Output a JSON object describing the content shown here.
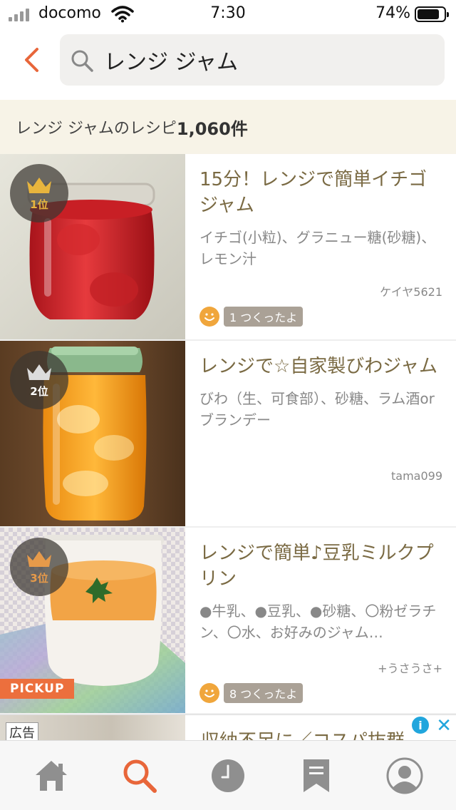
{
  "status_bar": {
    "carrier": "docomo",
    "time": "7:30",
    "battery": "74%"
  },
  "search": {
    "query": "レンジ ジャム"
  },
  "results": {
    "label": "レンジ ジャムのレシピ",
    "count": "1,060件"
  },
  "recipes": [
    {
      "rank": "1位",
      "title": "15分！レンジで簡単イチゴジャム",
      "ingredients": "イチゴ(小粒)、グラニュー糖(砂糖)、レモン汁",
      "author": "ケイヤ5621",
      "tsukurepo": "1 つくったよ",
      "colors": {
        "crown": "#e8b53d",
        "rank_text": "#e8b53d"
      }
    },
    {
      "rank": "2位",
      "title": "レンジで☆自家製びわジャム",
      "ingredients": "びわ（生、可食部）、砂糖、ラム酒orブランデー",
      "author": "tama099",
      "colors": {
        "crown": "#dcdcdc",
        "rank_text": "#ffffff"
      }
    },
    {
      "rank": "3位",
      "title": "レンジで簡単♪豆乳ミルクプリン",
      "ingredients": "●牛乳、●豆乳、●砂糖、〇粉ゼラチン、〇水、お好みのジャム…",
      "author": "+うさうさ+",
      "tsukurepo": "8 つくったよ",
      "badge": "PICKUP",
      "colors": {
        "crown": "#e69a4a",
        "rank_text": "#e69a4a"
      }
    }
  ],
  "ad": {
    "label": "広告",
    "title": "収納不足に／コスパ抜群"
  },
  "tabs": [
    {
      "name": "home-icon"
    },
    {
      "name": "search-icon"
    },
    {
      "name": "history-icon"
    },
    {
      "name": "bookmark-icon"
    },
    {
      "name": "profile-icon"
    }
  ],
  "colors": {
    "accent": "#e8663a",
    "brown": "#7a6a43",
    "tab_icon": "#8f8f8f"
  }
}
